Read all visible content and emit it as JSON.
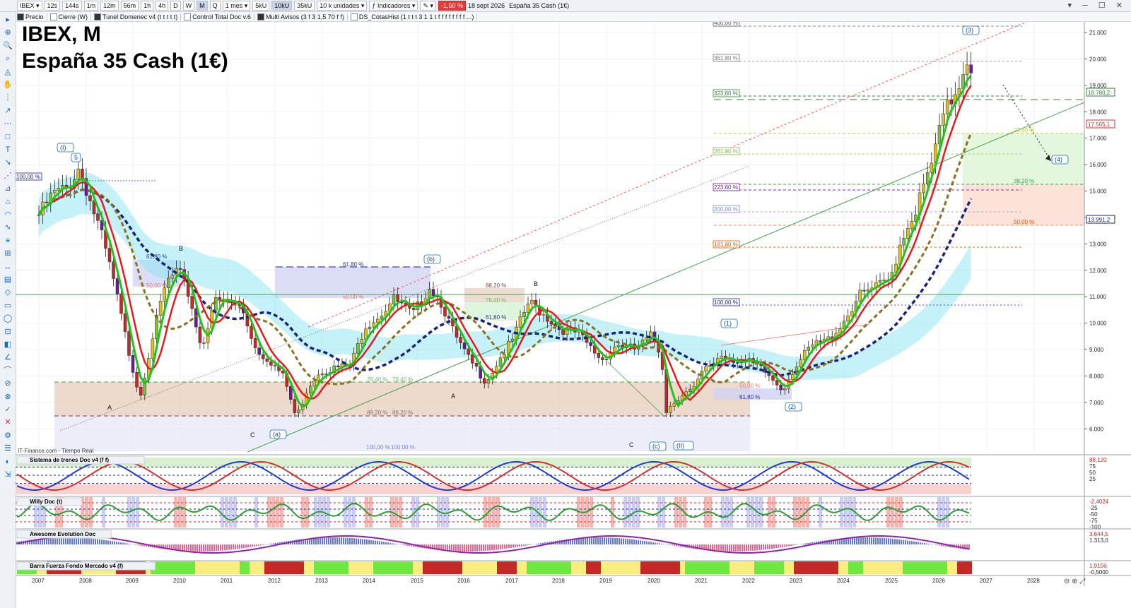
{
  "toolbar": {
    "symbol": "IBEX",
    "timeframes": [
      "12s",
      "144s",
      "1m",
      "12m",
      "56m",
      "1h",
      "4h",
      "D",
      "W",
      "M",
      "Q"
    ],
    "selected_timeframe": "M",
    "period": "1 mes",
    "units_buttons": [
      "5kU",
      "10kU",
      "35kU"
    ],
    "selected_unit": "10kU",
    "units_select": "10 k unidades",
    "indicators_label": "Indicadores",
    "change": "-1,50 %",
    "date": "18 sept 2026",
    "instrument": "España 35 Cash (1€)"
  },
  "indicator_bar": [
    {
      "label": "Precio",
      "checked": true
    },
    {
      "label": "Cierre (W)",
      "checked": false
    },
    {
      "label": "Tunel Domenec v4 (t t t t t)",
      "checked": true
    },
    {
      "label": "Control Total Doc v.6",
      "checked": false
    },
    {
      "label": "Multi Avisos (3 f 3 1,5 70 f f)",
      "checked": true
    },
    {
      "label": "DS_CotasHist (1 t t t 3 1 1 t f f f f f f f f ...)",
      "checked": false
    }
  ],
  "chart": {
    "title_line1": "IBEX, M",
    "title_line2": "España 35 Cash (1€)",
    "source": "IT-Finance.com - Tiempo Real",
    "price_ticks": [
      "21.000",
      "20.000",
      "19.000",
      "18.000",
      "17.000",
      "16.000",
      "15.000",
      "14.000",
      "13.000",
      "12.000",
      "11.000",
      "10.000",
      "9.000",
      "8.000",
      "7.000",
      "6.000"
    ],
    "price_labels": [
      {
        "text": "18.780,2",
        "color": "#2e7d32"
      },
      {
        "text": "17.565,1",
        "color": "#d32f2f"
      },
      {
        "text": "13.991,2",
        "color": "#1a237e"
      }
    ],
    "year_labels": [
      "2007",
      "2008",
      "2009",
      "2010",
      "2011",
      "2012",
      "2013",
      "2014",
      "2015",
      "2016",
      "2017",
      "2018",
      "2019",
      "2020",
      "2021",
      "2022",
      "2023",
      "2024",
      "2025",
      "2026",
      "2027",
      "2028"
    ],
    "fib_labels": [
      {
        "text": "400,00 %",
        "color": "#555555"
      },
      {
        "text": "361,80 %",
        "color": "#777777"
      },
      {
        "text": "323,60 %",
        "color": "#2e7d32"
      },
      {
        "text": "261,80 %",
        "color": "#7cb342"
      },
      {
        "text": "223,60 %",
        "color": "#6a1b9a"
      },
      {
        "text": "200,00 %",
        "color": "#7986cb"
      },
      {
        "text": "161,80 %",
        "color": "#e65100"
      },
      {
        "text": "100,00 %",
        "color": "#1a237e"
      },
      {
        "text": "100,00 %",
        "color": "#1a237e"
      },
      {
        "text": "61,80 %",
        "color": "#283593"
      },
      {
        "text": "50,00 %",
        "color": "#e57373"
      },
      {
        "text": "61,80 %",
        "color": "#283593"
      },
      {
        "text": "50,00 %",
        "color": "#e57373"
      },
      {
        "text": "88,20 %",
        "color": "#6d4c41"
      },
      {
        "text": "76,40 %",
        "color": "#66bb6a"
      },
      {
        "text": "61,80 %",
        "color": "#283593"
      },
      {
        "text": "76,40 %",
        "color": "#66bb6a"
      },
      {
        "text": "76,40 %",
        "color": "#66bb6a"
      },
      {
        "text": "88,20 %",
        "color": "#8d6e63"
      },
      {
        "text": "88,20 %",
        "color": "#8d6e63"
      },
      {
        "text": "100,00 %",
        "color": "#7986cb"
      },
      {
        "text": "100,00 %",
        "color": "#7986cb"
      },
      {
        "text": "50,00 %",
        "color": "#e57373"
      },
      {
        "text": "61,80 %",
        "color": "#283593"
      },
      {
        "text": "23,60 %",
        "color": "#c0ca33"
      },
      {
        "text": "38,20 %",
        "color": "#43a047"
      },
      {
        "text": "50,00 %",
        "color": "#e65100"
      }
    ],
    "wave_labels": [
      "(I)",
      "5",
      "B",
      "(b)",
      "B",
      "(1)",
      "(3)",
      "(4)",
      "A",
      "C",
      "(a)",
      "A",
      "C",
      "(c)",
      "(II)",
      "(2)"
    ]
  },
  "panels": [
    {
      "name": "Sistema de trenes Doc v4 (f f)",
      "values": [
        "88,120",
        "75",
        "50",
        "25"
      ]
    },
    {
      "name": "Willy Doc (t)",
      "values": [
        "-2,4024",
        "-25",
        "-50",
        "-75",
        "-100"
      ]
    },
    {
      "name": "Awesome Evolution Doc",
      "values": [
        "3.644,5",
        "1.313,0"
      ]
    },
    {
      "name": "Barra Fuerza Fondo Mercado v4 (f)",
      "values": [
        "1,9156",
        "-0,5000"
      ]
    }
  ],
  "colors": {
    "green_ma": "#22c21c",
    "red_ma": "#e31b1b",
    "navy_ma": "#1a237e",
    "brown_ma": "#8d6e1f",
    "cyan_band": "#7fe3f0"
  }
}
